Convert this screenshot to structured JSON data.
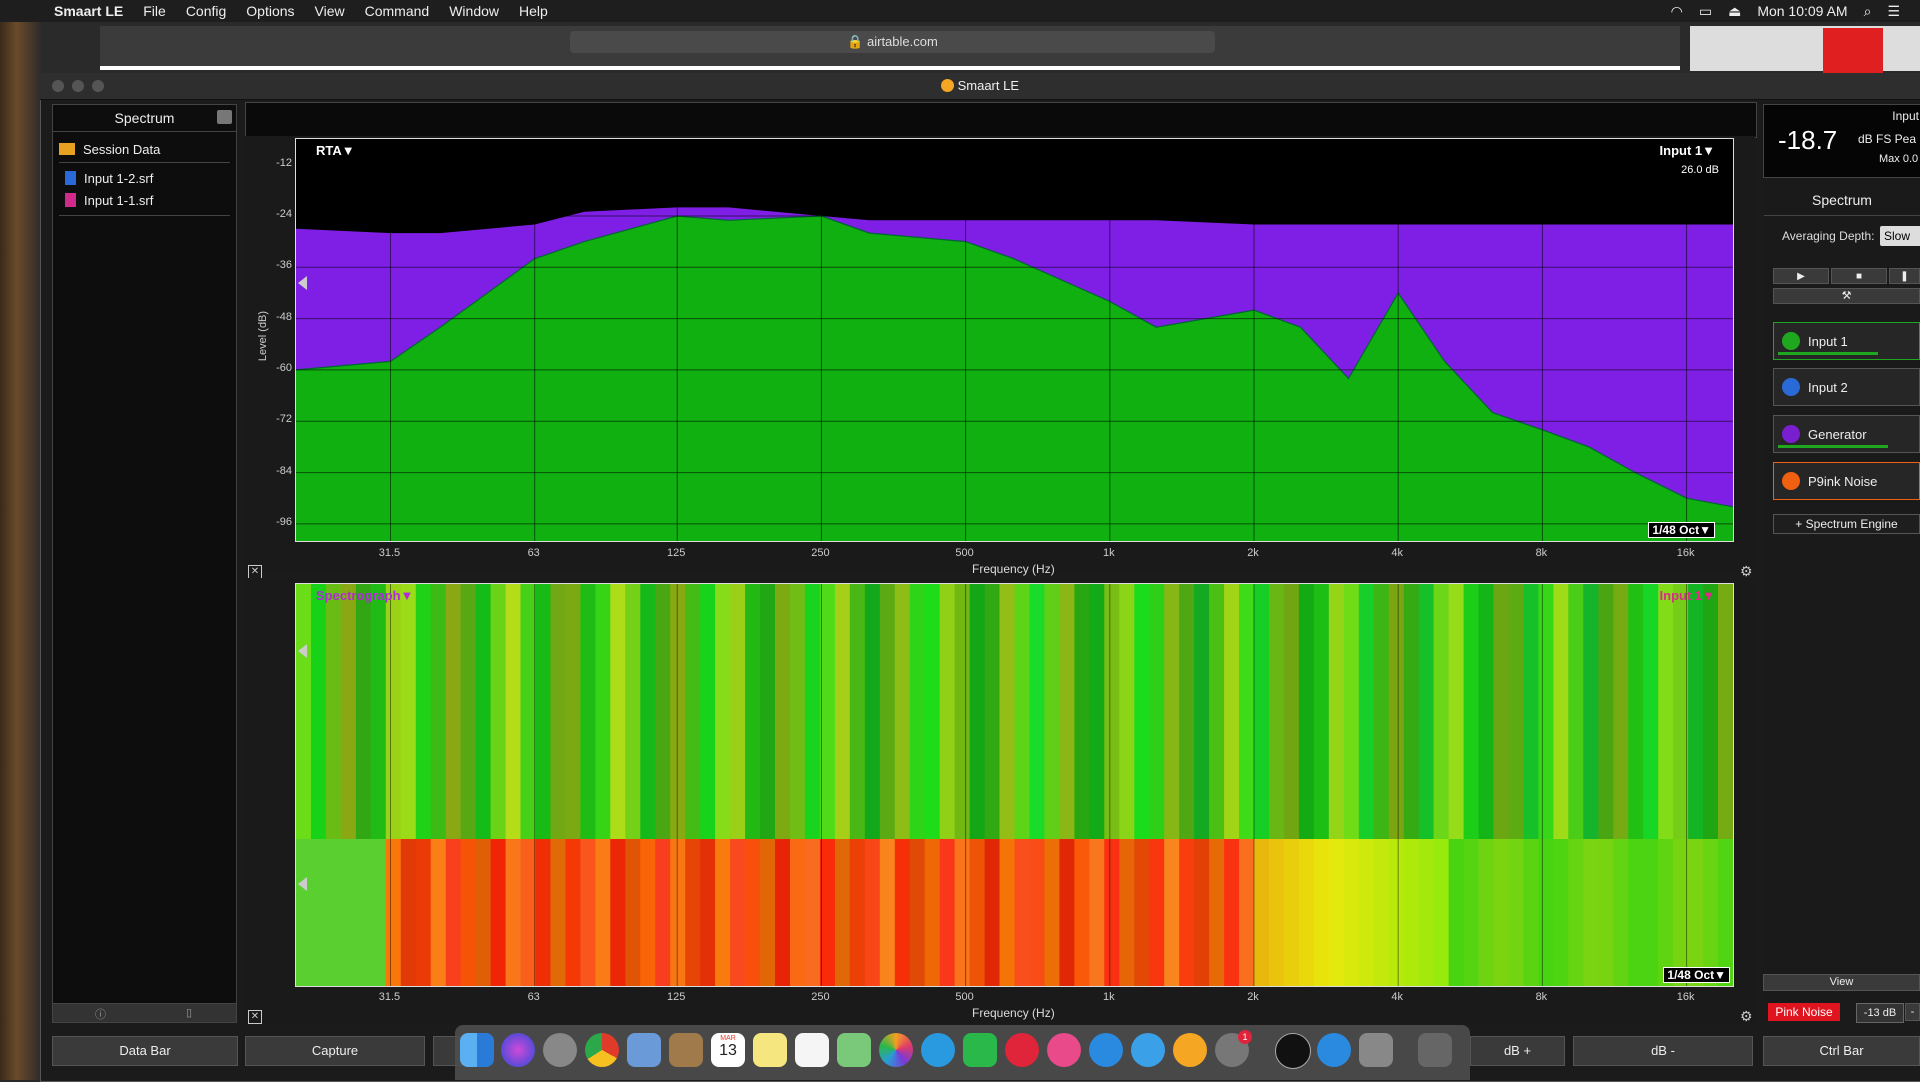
{
  "menubar": {
    "app": "Smaart LE",
    "items": [
      "File",
      "Config",
      "Options",
      "View",
      "Command",
      "Window",
      "Help"
    ],
    "clock": "Mon 10:09 AM"
  },
  "browser": {
    "url": "airtable.com"
  },
  "window": {
    "title": "Smaart LE"
  },
  "sidebar": {
    "title": "Spectrum",
    "folder": "Session Data",
    "files": [
      "Input 1-2.srf",
      "Input 1-1.srf"
    ]
  },
  "rta": {
    "label": "RTA▼",
    "input_label": "Input 1▼",
    "db_value": "26.0 dB",
    "resolution": "1/48 Oct▼",
    "ylabel": "Level (dB)",
    "xlabel": "Frequency (Hz)",
    "yticks": [
      "-12",
      "-24",
      "-36",
      "-48",
      "-60",
      "-72",
      "-84",
      "-96"
    ],
    "xticks": [
      "31.5",
      "63",
      "125",
      "250",
      "500",
      "1k",
      "2k",
      "4k",
      "8k",
      "16k"
    ]
  },
  "spectrograph": {
    "label": "Spectrograph▼",
    "input_label": "Input 1▼",
    "resolution": "1/48 Oct▼",
    "xlabel": "Frequency (Hz)",
    "xticks": [
      "31.5",
      "63",
      "125",
      "250",
      "500",
      "1k",
      "2k",
      "4k",
      "8k",
      "16k"
    ]
  },
  "meter": {
    "input": "Input",
    "value": "-18.7",
    "unit": "dB FS Pea",
    "max": "Max 0.0"
  },
  "right_panel": {
    "title": "Spectrum",
    "averaging_label": "Averaging Depth:",
    "averaging_value": "Slow",
    "inputs": [
      {
        "name": "Input 1",
        "color": "#1fa81f"
      },
      {
        "name": "Input 2",
        "color": "#2a6ad8"
      },
      {
        "name": "Generator",
        "color": "#7a1fd0"
      },
      {
        "name": "P9ink Noise",
        "color": "#f06010"
      }
    ],
    "add_engine": "+ Spectrum Engine",
    "view": "View",
    "pink_noise": "Pink Noise",
    "gen_level": "-13 dB"
  },
  "bottom_bar": {
    "data_bar": "Data Bar",
    "capture": "Capture",
    "db_plus": "dB +",
    "db_minus": "dB -",
    "ctrl_bar": "Ctrl Bar"
  },
  "dock": {
    "calendar_month": "MAR",
    "calendar_day": "13",
    "badge": "1"
  },
  "colors": {
    "rta_green": "#10b010",
    "rta_purple": "#7f1fe6",
    "accent": "#f5a623"
  },
  "chart_data": {
    "type": "area",
    "title": "RTA",
    "xlabel": "Frequency (Hz)",
    "ylabel": "Level (dB)",
    "x": [
      20,
      31.5,
      40,
      63,
      80,
      125,
      160,
      250,
      315,
      500,
      630,
      1000,
      1250,
      2000,
      2500,
      3150,
      4000,
      5000,
      6300,
      8000,
      10000,
      12500,
      16000,
      20000
    ],
    "ylim": [
      -100,
      -6
    ],
    "series": [
      {
        "name": "Input 1",
        "values": [
          -60,
          -58,
          -50,
          -34,
          -30,
          -24,
          -25,
          -24,
          -28,
          -30,
          -34,
          -44,
          -50,
          -46,
          -50,
          -62,
          -42,
          -58,
          -70,
          -74,
          -78,
          -84,
          -90,
          -92
        ]
      },
      {
        "name": "Generator",
        "values": [
          -27,
          -28,
          -28,
          -26,
          -23,
          -22,
          -22,
          -24,
          -25,
          -25,
          -25,
          -25,
          -25,
          -26,
          -26,
          -26,
          -26,
          -26,
          -26,
          -26,
          -26,
          -26,
          -26,
          -26
        ]
      }
    ],
    "grid": true
  }
}
